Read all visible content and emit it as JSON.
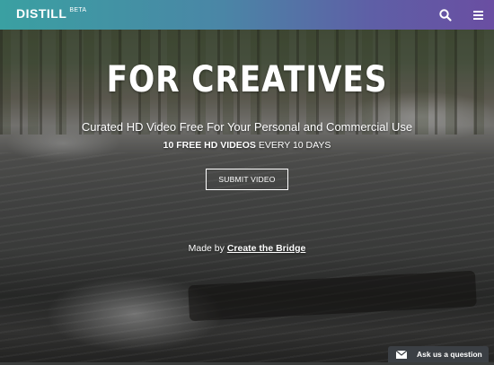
{
  "header": {
    "logo": "DISTILL",
    "beta": "BETA",
    "search_icon": "search-icon",
    "menu_icon": "hamburger-menu-icon"
  },
  "hero": {
    "headline": "FOR CREATIVES",
    "subtitle": "Curated HD Video Free For Your Personal and Commercial Use",
    "tagline_bold": "10 FREE HD VIDEOS",
    "tagline_rest": " EVERY 10 DAYS",
    "submit_label": "SUBMIT VIDEO"
  },
  "credit": {
    "prefix": "Made by ",
    "link": "Create the Bridge"
  },
  "chat_widget": {
    "label": "Ask us a question",
    "icon": "envelope-icon"
  },
  "colors": {
    "nav_gradient_start": "#3aa0a2",
    "nav_gradient_end": "#6a4ea2",
    "widget_bg": "#3b3f44"
  }
}
